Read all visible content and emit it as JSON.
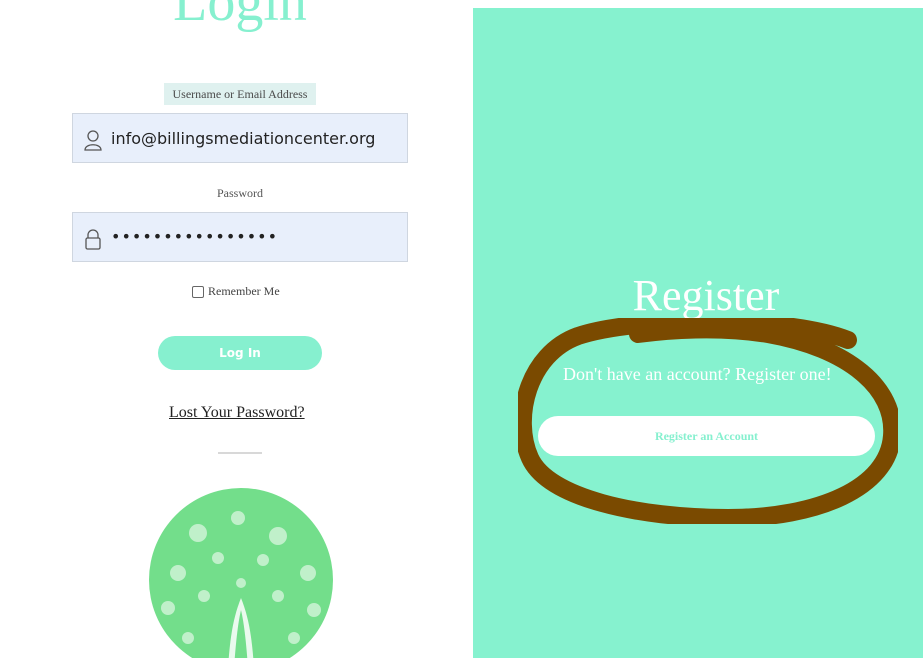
{
  "login": {
    "title": "Login",
    "username_label": "Username or Email Address",
    "username_value": "info@billingsmediationcenter.org",
    "password_label": "Password",
    "password_value": "••••••••••••••••",
    "remember_label": "Remember Me",
    "login_button": "Log In",
    "lost_password": "Lost Your Password?",
    "icons": [
      "user-icon",
      "lock-icon",
      "tree-logo"
    ]
  },
  "register": {
    "title": "Register",
    "text": "Don't have an account? Register one!",
    "button": "Register an Account"
  },
  "colors": {
    "mint": "#86F2CF",
    "annotation_brown": "#7A4A00",
    "field_bg": "#E8EFFB",
    "logo_green": "#73DE8B"
  }
}
